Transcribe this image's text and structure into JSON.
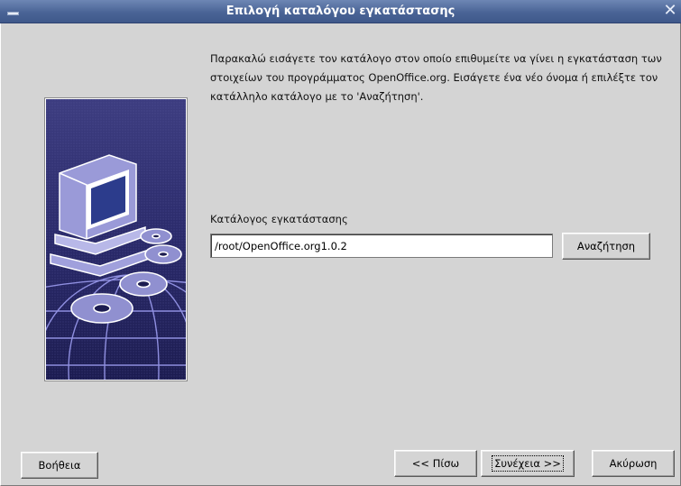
{
  "window": {
    "title": "Επιλογή καταλόγου εγκατάστασης",
    "close_glyph": "✕"
  },
  "instructions": "Παρακαλώ εισάγετε τον κατάλογο στον οποίο επιθυμείτε να γίνει η εγκατάσταση των στοιχείων του προγράμματος OpenOffice.org. Εισάγετε ένα νέο όνομα ή επιλέξτε τον κατάλληλο κατάλογο με το 'Αναζήτηση'.",
  "install_dir": {
    "label": "Κατάλογος εγκατάστασης",
    "value": "/root/OpenOffice.org1.0.2"
  },
  "buttons": {
    "browse": "Αναζήτηση",
    "help": "Βοήθεια",
    "back": "<< Πίσω",
    "next": "Συνέχεια >>",
    "cancel": "Ακύρωση"
  },
  "colors": {
    "titlebar": "#4a6496",
    "dialog_bg": "#d4d4d4",
    "art_bg": "#2a2a6a",
    "art_accent": "#8f8fe0"
  },
  "icons": [
    "menu-icon",
    "close-icon",
    "computer-cd-globe-illustration"
  ]
}
